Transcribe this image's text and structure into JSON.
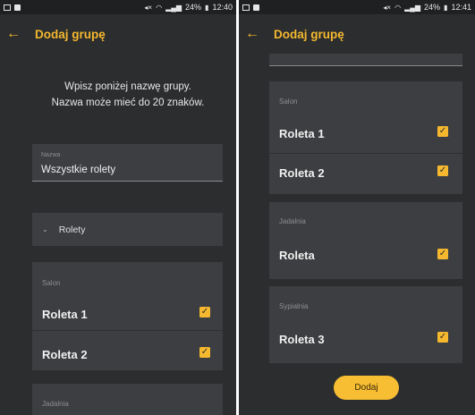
{
  "colors": {
    "accent": "#f5b82e",
    "background": "#2b2d2f",
    "card": "#3c3e41"
  },
  "status_left": {
    "battery": "24%",
    "time": "12:40"
  },
  "status_right": {
    "battery": "24%",
    "time": "12:41"
  },
  "appbar": {
    "title": "Dodaj grupę",
    "back_icon": "arrow-left-icon"
  },
  "left": {
    "intro_line1": "Wpisz poniżej nazwę grupy.",
    "intro_line2": "Nazwa może mieć do 20 znaków.",
    "name_field": {
      "label": "Nazwa",
      "value": "Wszystkie rolety"
    },
    "dropdown": {
      "label": "Rolety",
      "icon": "chevron-down-icon"
    },
    "salon": {
      "room": "Salon",
      "items": [
        {
          "label": "Roleta 1",
          "checked": true
        },
        {
          "label": "Roleta 2",
          "checked": true
        }
      ]
    },
    "jadalnia": {
      "room": "Jadalnia"
    }
  },
  "right": {
    "salon": {
      "room": "Salon",
      "items": [
        {
          "label": "Roleta 1",
          "checked": true
        },
        {
          "label": "Roleta 2",
          "checked": true
        }
      ]
    },
    "jadalnia": {
      "room": "Jadalnia",
      "items": [
        {
          "label": "Roleta",
          "checked": true
        }
      ]
    },
    "sypialnia": {
      "room": "Sypialnia",
      "items": [
        {
          "label": "Roleta 3",
          "checked": true
        }
      ]
    },
    "add_button": "Dodaj"
  }
}
